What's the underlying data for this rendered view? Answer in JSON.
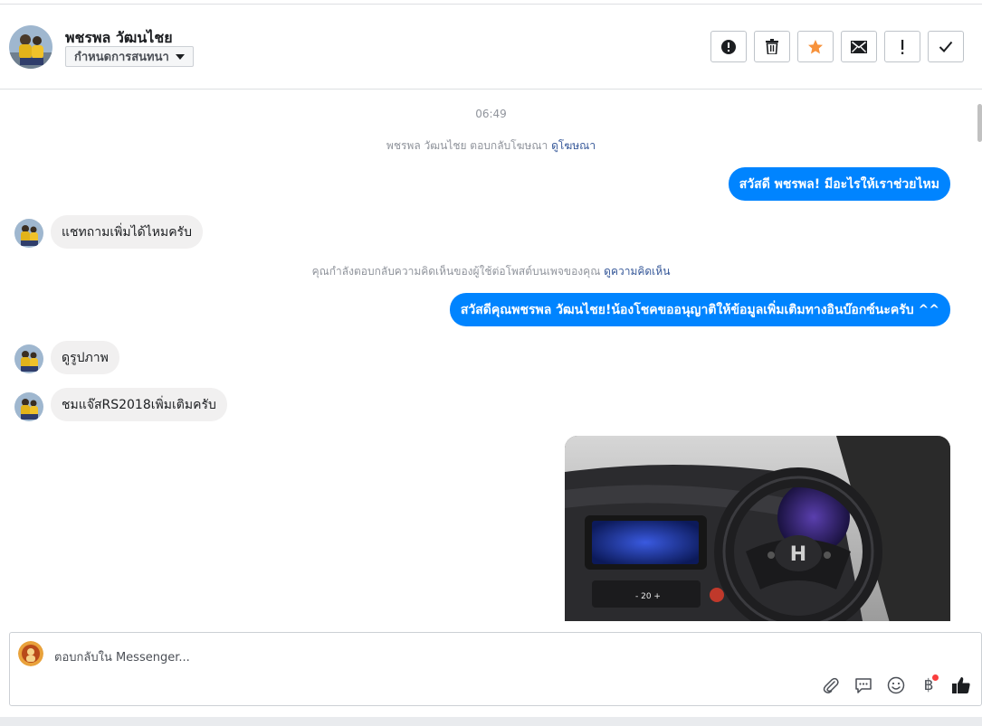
{
  "header": {
    "contact_name": "พชรพล วัฒนไชย",
    "assign_label": "กำหนดการสนทนา",
    "actions": [
      {
        "name": "spam-button",
        "icon": "alert-circle-icon"
      },
      {
        "name": "delete-button",
        "icon": "trash-icon"
      },
      {
        "name": "star-button",
        "icon": "star-icon",
        "color": "#f7923b"
      },
      {
        "name": "mark-unread-button",
        "icon": "envelope-icon"
      },
      {
        "name": "follow-up-button",
        "icon": "exclamation-icon"
      },
      {
        "name": "mark-done-button",
        "icon": "check-icon"
      }
    ]
  },
  "thread": {
    "timestamp": "06:49",
    "sys1": {
      "text": "พชรพล วัฒนไชย ตอบกลับโฆษณา",
      "link": "ดูโฆษณา"
    },
    "msg1": "สวัสดี พชรพล! มีอะไรให้เราช่วยไหม",
    "msg2": "แชทถามเพิ่มได้ไหมครับ",
    "sys2": {
      "text": "คุณกำลังตอบกลับความคิดเห็นของผู้ใช้ต่อโพสต์บนเพจของคุณ",
      "link": "ดูความคิดเห็น"
    },
    "msg3": "สวัสดีคุณพชรพล วัฒนไชย!น้องโชคขออนุญาติให้ข้อมูลเพิ่มเติมทางอินบ๊อกซ์นะครับ ^^",
    "msg4": "ดูรูปภาพ",
    "msg5": "ชมแจ๊สRS2018เพิ่มเติมครับ",
    "photo_brand": "H"
  },
  "composer": {
    "placeholder": "ตอบกลับใน Messenger...",
    "payment_symbol": "฿"
  },
  "colors": {
    "outgoing": "#0084ff",
    "incoming": "#f1f0f0",
    "link": "#365899",
    "accent_star": "#f7923b"
  }
}
